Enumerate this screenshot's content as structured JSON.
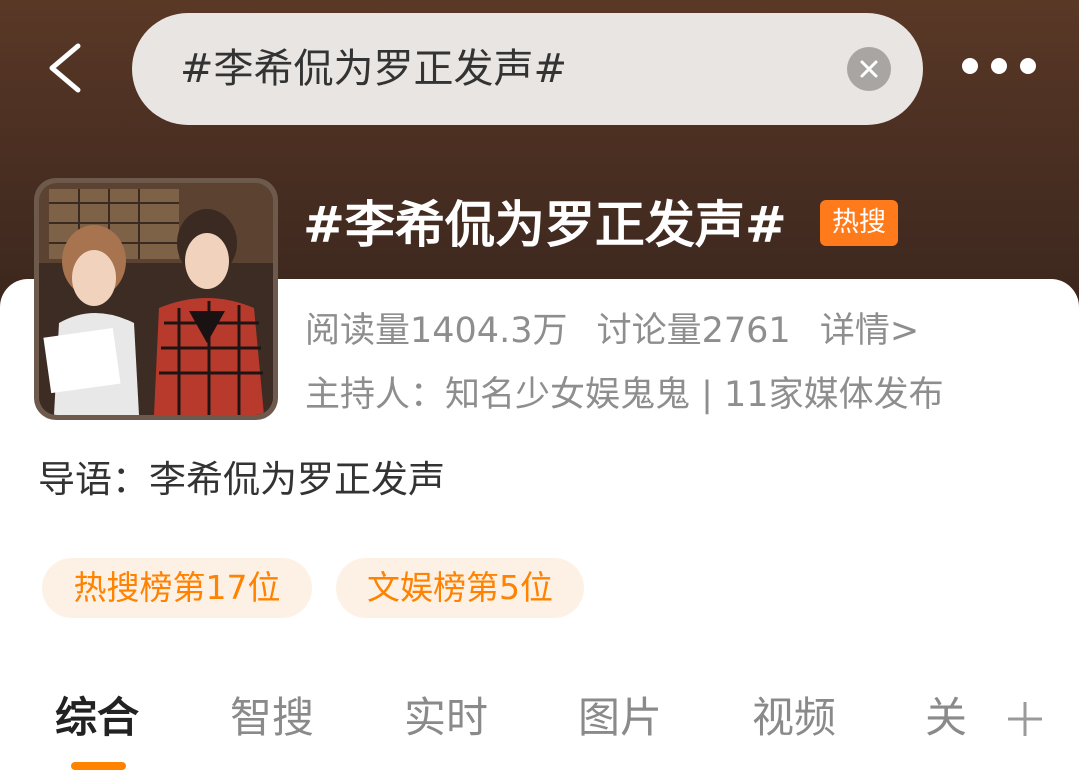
{
  "header": {
    "back_icon": "chevron-left-icon",
    "search_value": "#李希侃为罗正发声#",
    "clear_icon": "close-icon",
    "more_icon": "ellipsis-icon"
  },
  "topic": {
    "title": "#李希侃为罗正发声#",
    "badge": "热搜",
    "reads": "阅读量1404.3万",
    "discussions": "讨论量2761",
    "details_link": "详情>",
    "host_line": "主持人：知名少女娱鬼鬼 | 11家媒体发布",
    "intro": "导语：李希侃为罗正发声"
  },
  "tags": [
    {
      "label": "热搜榜第17位"
    },
    {
      "label": "文娱榜第5位"
    }
  ],
  "tabs": [
    {
      "label": "综合",
      "active": true
    },
    {
      "label": "智搜"
    },
    {
      "label": "实时"
    },
    {
      "label": "图片"
    },
    {
      "label": "视频"
    },
    {
      "label": "关"
    }
  ],
  "colors": {
    "accent": "#ff8200",
    "badge": "#ff7a1a",
    "tag_bg": "#fdf1e6",
    "hero_bg": "#4a2f22"
  }
}
